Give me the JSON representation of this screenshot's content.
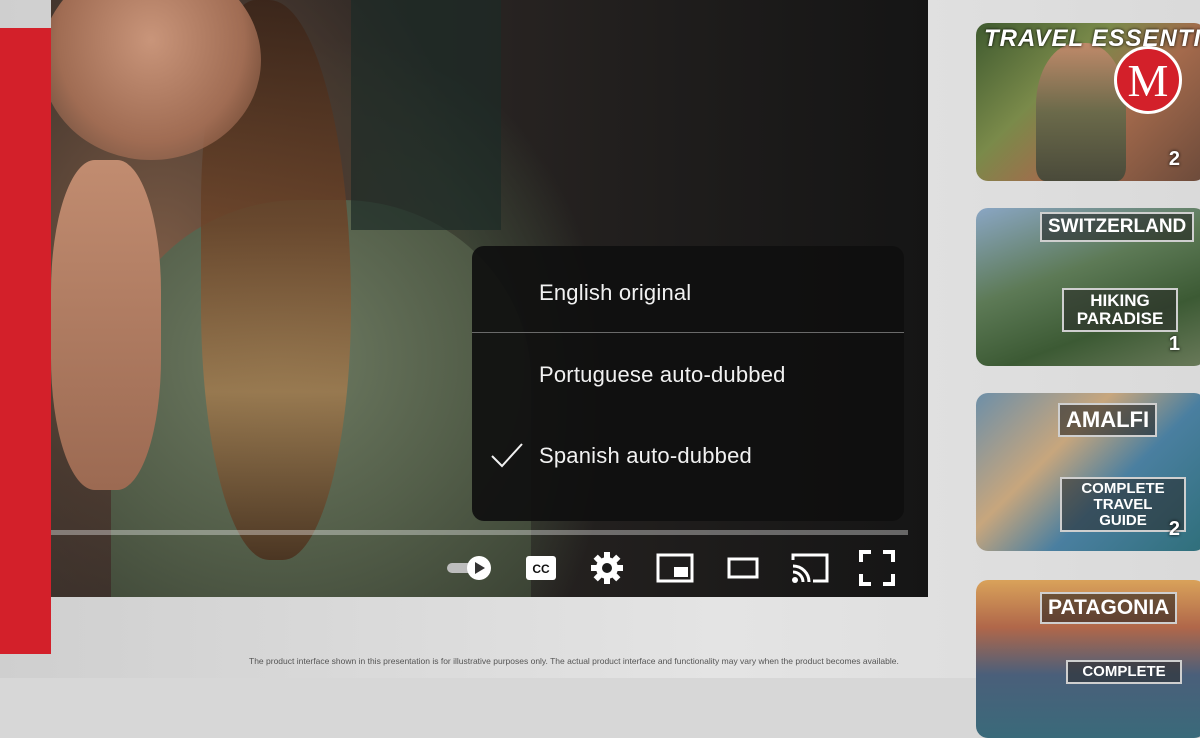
{
  "audio_menu": {
    "items": [
      {
        "label": "English original",
        "selected": false
      },
      {
        "label": "Portuguese auto-dubbed",
        "selected": false
      },
      {
        "label": "Spanish auto-dubbed",
        "selected": true
      }
    ]
  },
  "player_controls": {
    "icons": [
      "autoplay-toggle-icon",
      "closed-captions-icon",
      "settings-gear-icon",
      "miniplayer-icon",
      "theater-mode-icon",
      "cast-icon",
      "fullscreen-icon"
    ],
    "captions_label": "CC"
  },
  "sidebar": {
    "thumbnails": [
      {
        "title": "TRAVEL ESSENTI",
        "subtitle": "",
        "duration": "2"
      },
      {
        "title": "SWITZERLAND",
        "subtitle": "HIKING PARADISE",
        "duration": "1"
      },
      {
        "title": "AMALFI",
        "subtitle": "COMPLETE TRAVEL GUIDE",
        "duration": "2"
      },
      {
        "title": "PATAGONIA",
        "subtitle": "COMPLETE",
        "duration": ""
      }
    ]
  },
  "watermark": {
    "logo_letter": "M"
  },
  "disclaimer": "The product interface shown in this presentation is for illustrative purposes only. The actual product interface and functionality may vary when the product becomes available.",
  "colors": {
    "accent_red": "#d3202a",
    "menu_bg": "#0f0f0f",
    "menu_text": "#f1f1f1"
  }
}
